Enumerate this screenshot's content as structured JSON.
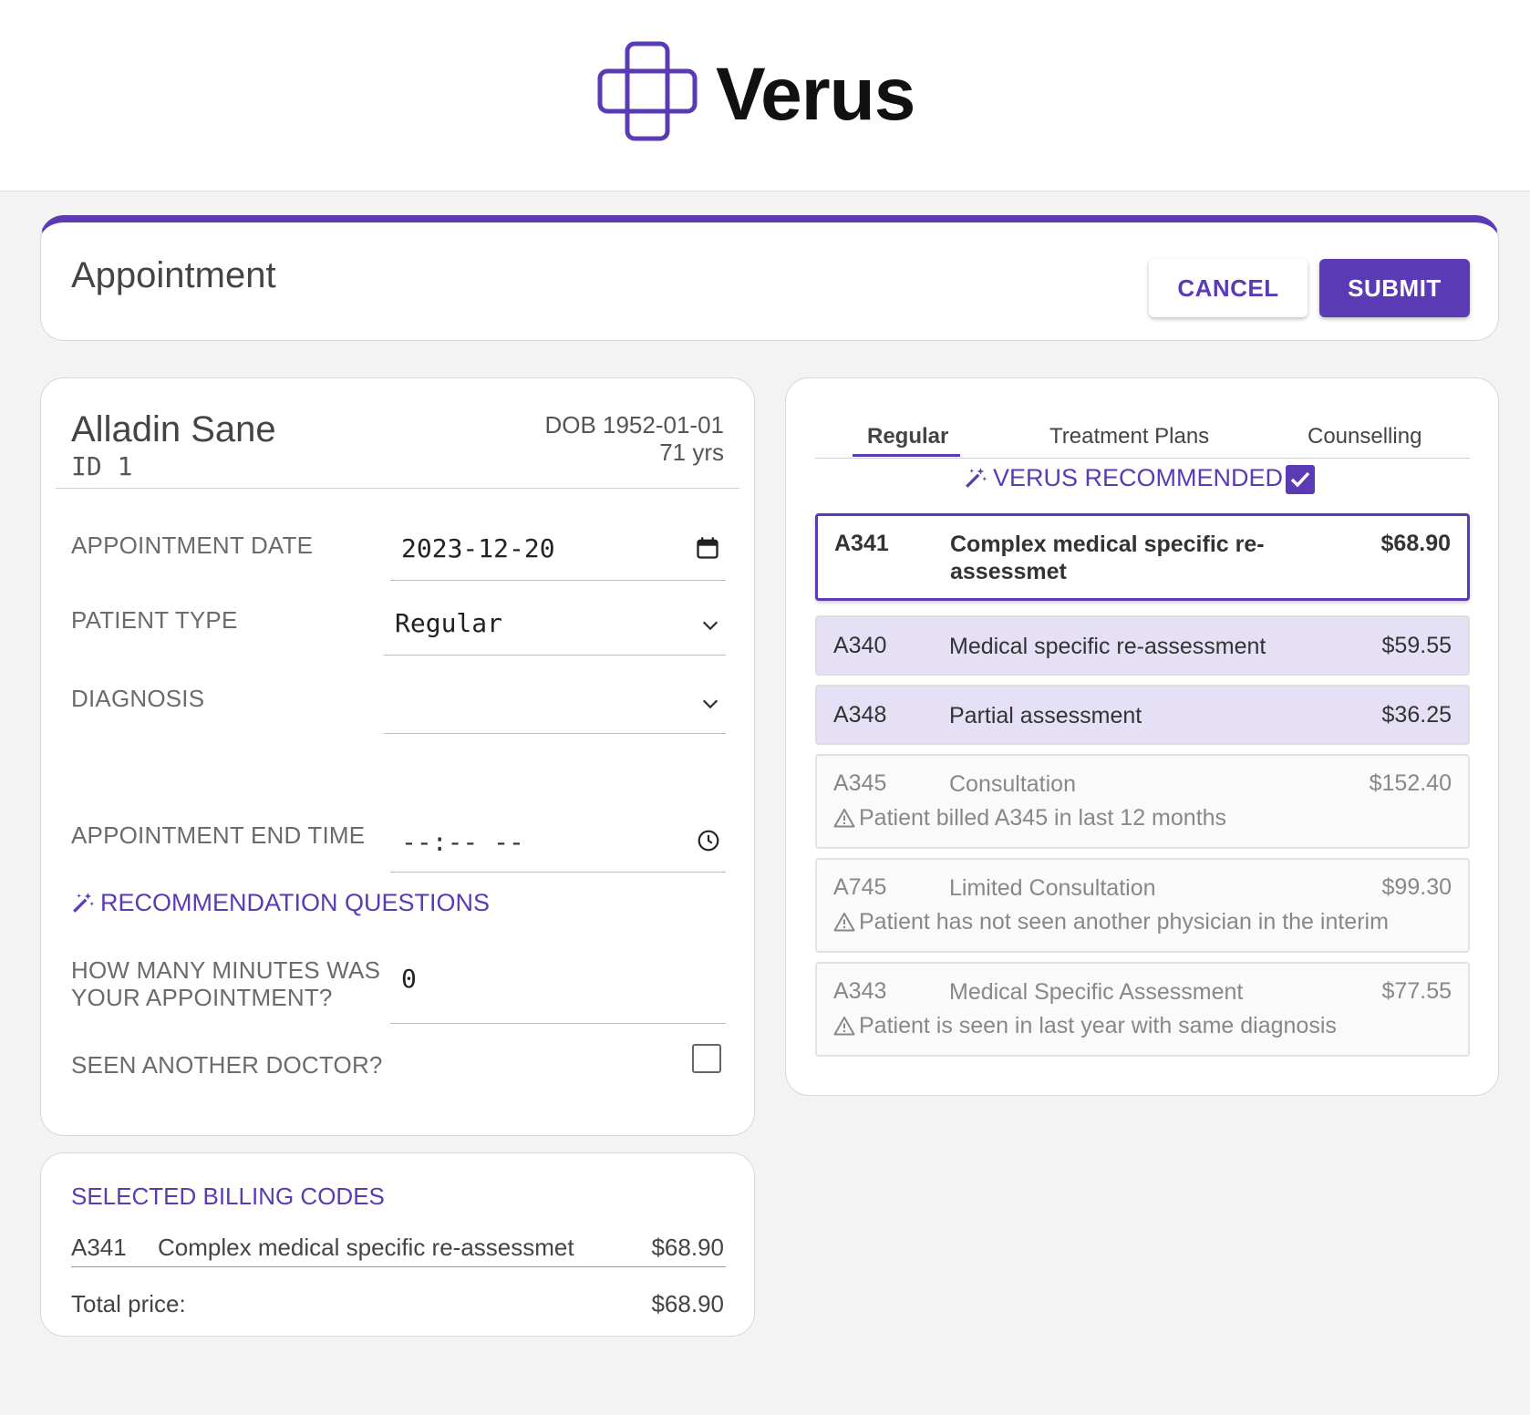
{
  "brand": {
    "name": "Verus",
    "color": "#5a3bb5"
  },
  "appointment": {
    "title": "Appointment",
    "cancel_label": "CANCEL",
    "submit_label": "SUBMIT"
  },
  "patient": {
    "name": "Alladin Sane",
    "id": "ID 1",
    "dob": "DOB 1952-01-01",
    "age": "71 yrs"
  },
  "form": {
    "appointment_date": {
      "label": "APPOINTMENT DATE",
      "value": "2023-12-20",
      "icon": "calendar-icon"
    },
    "patient_type": {
      "label": "PATIENT TYPE",
      "value": "Regular",
      "icon": "chevron-down-icon"
    },
    "diagnosis": {
      "label": "DIAGNOSIS",
      "value": "",
      "icon": "chevron-down-icon"
    },
    "end_time": {
      "label": "APPOINTMENT END TIME",
      "value": "--:-- --",
      "icon": "clock-icon"
    },
    "recommendation_questions": "RECOMMENDATION QUESTIONS",
    "minutes": {
      "label_line1": "HOW MANY MINUTES WAS",
      "label_line2": "YOUR APPOINTMENT?",
      "value": "0"
    },
    "seen_another": {
      "label": "SEEN ANOTHER DOCTOR?",
      "checked": false
    }
  },
  "billing": {
    "title": "SELECTED BILLING CODES",
    "items": [
      {
        "code": "A341",
        "description": "Complex medical specific re-assessmet",
        "price": "$68.90"
      }
    ],
    "total_label": "Total price:",
    "total_value": "$68.90"
  },
  "codes_panel": {
    "tabs": [
      {
        "label": "Regular",
        "active": true
      },
      {
        "label": "Treatment Plans",
        "active": false
      },
      {
        "label": "Counselling",
        "active": false
      }
    ],
    "verus_recommended": {
      "label": "VERUS RECOMMENDED",
      "checked": true
    },
    "items": [
      {
        "code": "A341",
        "description": "Complex medical specific re-assessmet",
        "price": "$68.90",
        "state": "selected"
      },
      {
        "code": "A340",
        "description": "Medical specific re-assessment",
        "price": "$59.55",
        "state": "recommended"
      },
      {
        "code": "A348",
        "description": "Partial assessment",
        "price": "$36.25",
        "state": "recommended"
      },
      {
        "code": "A345",
        "description": "Consultation",
        "price": "$152.40",
        "state": "warning",
        "warning": "Patient billed A345 in last 12 months"
      },
      {
        "code": "A745",
        "description": "Limited Consultation",
        "price": "$99.30",
        "state": "warning",
        "warning": "Patient has not seen another physician in the interim"
      },
      {
        "code": "A343",
        "description": "Medical Specific Assessment",
        "price": "$77.55",
        "state": "warning",
        "warning": "Patient is seen in last year with same diagnosis"
      }
    ]
  }
}
